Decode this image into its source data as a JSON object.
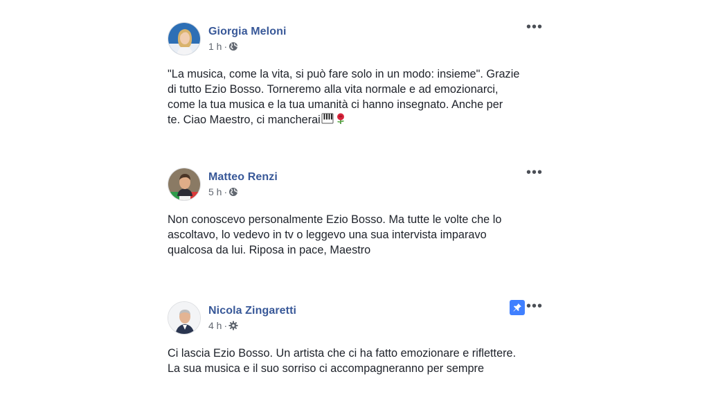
{
  "posts": [
    {
      "author": "Giorgia Meloni",
      "time": "1 h",
      "privacy_icon": "globe-icon",
      "text": "\"La musica, come la vita, si può fare solo in un modo: insieme\". Grazie\ndi tutto Ezio Bosso. Torneremo alla vita normale e ad emozionarci,\ncome la tua musica e la tua umanità ci hanno insegnato. Anche per\nte. Ciao Maestro, ci mancherai",
      "emojis": [
        "piano-emoji",
        "rose-emoji"
      ],
      "more_label": "•••"
    },
    {
      "author": "Matteo Renzi",
      "time": "5 h",
      "privacy_icon": "globe-icon",
      "text": "Non conoscevo personalmente Ezio Bosso. Ma tutte le volte che lo\nascoltavo, lo vedevo in tv o leggevo una sua intervista imparavo\nqualcosa da lui. Riposa in pace, Maestro",
      "more_label": "•••"
    },
    {
      "author": "Nicola Zingaretti",
      "time": "4 h",
      "privacy_icon": "gear-icon",
      "pinned": true,
      "text": "Ci lascia Ezio Bosso. Un artista che ci ha fatto emozionare e riflettere.\nLa sua musica e il suo sorriso ci accompagneranno per sempre",
      "more_label": "•••"
    }
  ],
  "colors": {
    "author_link": "#385898",
    "meta_text": "#616770",
    "body_text": "#1d2129",
    "pin_bg": "#4080ff"
  }
}
